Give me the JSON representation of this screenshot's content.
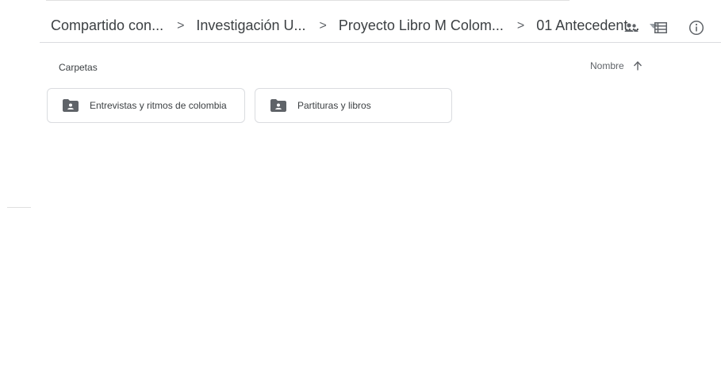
{
  "breadcrumb": {
    "items": [
      "Compartido con...",
      "Investigación U...",
      "Proyecto Libro M Colom...",
      "01 Antecedent..."
    ],
    "separator": ">"
  },
  "toolbar": {
    "shared_icon": "people-icon",
    "view_icon": "list-view-icon",
    "info_icon": "info-icon"
  },
  "folders_section": {
    "label": "Carpetas",
    "sort_label": "Nombre",
    "sort_direction": "ascending"
  },
  "folders": [
    {
      "name": "Entrevistas y ritmos de colombia",
      "icon": "shared-folder-icon"
    },
    {
      "name": "Partituras y libros",
      "icon": "shared-folder-icon"
    }
  ],
  "colors": {
    "text": "#3c4043",
    "icon": "#5f6368",
    "border": "#dadce0"
  }
}
